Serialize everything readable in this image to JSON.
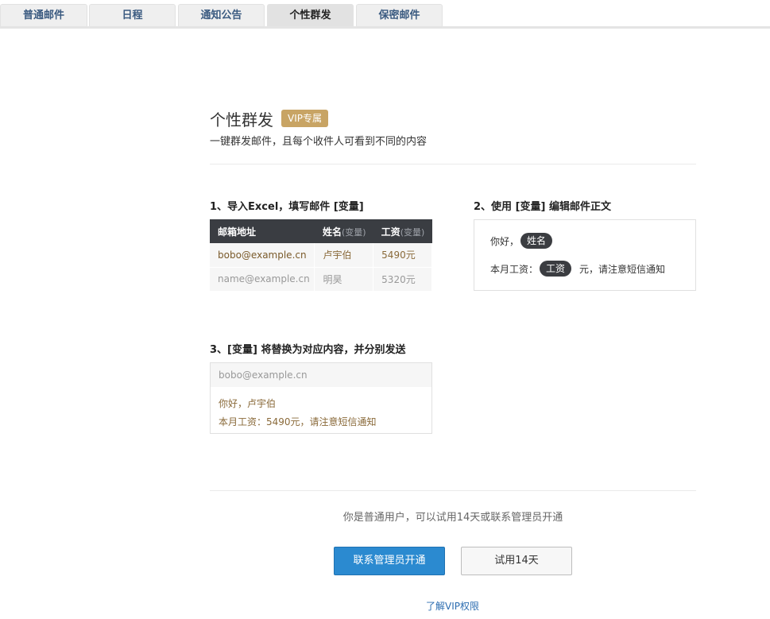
{
  "tabs": [
    {
      "label": "普通邮件",
      "active": false
    },
    {
      "label": "日程",
      "active": false
    },
    {
      "label": "通知公告",
      "active": false
    },
    {
      "label": "个性群发",
      "active": true
    },
    {
      "label": "保密邮件",
      "active": false
    }
  ],
  "header": {
    "title": "个性群发",
    "badge": "VIP专属",
    "subtitle": "一键群发邮件，且每个收件人可看到不同的内容"
  },
  "step1": {
    "title": "1、导入Excel，填写邮件 [变量]",
    "columns": [
      {
        "label": "邮箱地址",
        "var": ""
      },
      {
        "label": "姓名",
        "var": "(变量)"
      },
      {
        "label": "工资",
        "var": "(变量)"
      }
    ],
    "rows": [
      [
        "bobo@example.cn",
        "卢宇伯",
        "5490元"
      ],
      [
        "name@example.cn",
        "明昊",
        "5320元"
      ]
    ]
  },
  "step2": {
    "title": "2、使用 [变量] 编辑邮件正文",
    "line1_prefix": "你好，",
    "line1_var": "姓名",
    "line2_prefix": "本月工资：",
    "line2_var": "工资",
    "line2_suffix": "元，请注意短信通知"
  },
  "step3": {
    "title": "3、[变量] 将替换为对应内容，并分别发送",
    "email": "bobo@example.cn",
    "line1": "你好，卢宇伯",
    "line2": "本月工资：5490元，请注意短信通知"
  },
  "footer": {
    "notice": "你是普通用户，可以试用14天或联系管理员开通",
    "primary_button": "联系管理员开通",
    "secondary_button": "试用14天",
    "vip_link": "了解VIP权限"
  },
  "colors": {
    "badge": "#c8a464",
    "primary": "#2b8ad0",
    "pill": "#3b3d41"
  }
}
